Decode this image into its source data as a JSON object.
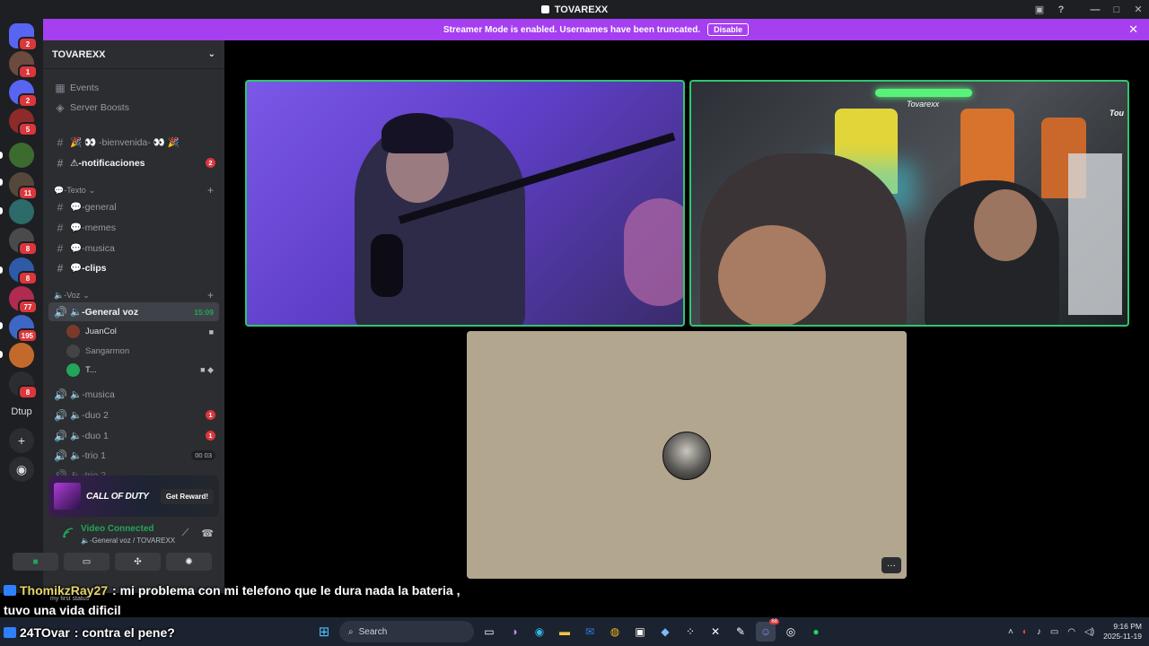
{
  "window": {
    "title": "TOVAREXX"
  },
  "banner": {
    "message": "Streamer Mode is enabled. Usernames have been truncated.",
    "disable_label": "Disable",
    "close_glyph": "✕"
  },
  "rail": {
    "servers": [
      {
        "name": "home",
        "badge": "2",
        "color": "#5865f2"
      },
      {
        "name": "server-1",
        "badge": "1",
        "color": "#6b4b3e"
      },
      {
        "name": "server-2",
        "badge": "2",
        "color": "#5865f2"
      },
      {
        "name": "server-3",
        "badge": "5",
        "color": "#8e2a2a"
      },
      {
        "name": "server-4",
        "badge": "",
        "color": "#3c6b2f"
      },
      {
        "name": "server-5",
        "badge": "11",
        "color": "#55483a"
      },
      {
        "name": "server-6",
        "badge": "",
        "color": "#2d6a6a"
      },
      {
        "name": "server-7",
        "badge": "8",
        "color": "#4a4a4a"
      },
      {
        "name": "server-8",
        "badge": "8",
        "color": "#2e5aa8"
      },
      {
        "name": "server-9",
        "badge": "77",
        "color": "#b12a50"
      },
      {
        "name": "server-10",
        "badge": "195",
        "color": "#3d66c6"
      },
      {
        "name": "server-11",
        "badge": "",
        "color": "#c26a2b"
      },
      {
        "name": "server-12",
        "badge": "8",
        "color": "#2b2d31"
      }
    ],
    "folder_label": "Dtup",
    "add_glyph": "+",
    "discover_glyph": "◉"
  },
  "sidebar": {
    "server_name": "TOVAREXX",
    "items": [
      {
        "type": "link",
        "label": "Events",
        "icon": "calendar-icon"
      },
      {
        "type": "link",
        "label": "Server Boosts",
        "icon": "boost-icon"
      }
    ],
    "channels_top": [
      {
        "label": "🎉 👀 -bienvenida- 👀 🎉",
        "bright": false,
        "badge": ""
      },
      {
        "label": "⚠-notificaciones",
        "bright": true,
        "badge": "2"
      }
    ],
    "category_text": "💬-Texto",
    "text_channels": [
      {
        "label": "💬-general",
        "bright": false
      },
      {
        "label": "💬-memes",
        "bright": false
      },
      {
        "label": "💬-musica",
        "bright": false
      },
      {
        "label": "💬-clips",
        "bright": true
      }
    ],
    "category_voice": "🔈-Voz",
    "active_voice": {
      "label": "🔈-General voz",
      "timer": "15:09"
    },
    "voice_users": [
      {
        "name": "JuanCol",
        "muted": false,
        "end": "🎥"
      },
      {
        "name": "Sangarmon",
        "muted": true,
        "end": ""
      },
      {
        "name": "T...",
        "muted": false,
        "end": "🎥 💬"
      }
    ],
    "voice_channels": [
      {
        "label": "🔈-musica",
        "badge": "",
        "count": ""
      },
      {
        "label": "🔈-duo 2",
        "badge": "1",
        "count": ""
      },
      {
        "label": "🔈-duo 1",
        "badge": "1",
        "count": ""
      },
      {
        "label": "🔈-trio 1",
        "badge": "",
        "count": "00 03"
      },
      {
        "label": "🔈-trio 2",
        "badge": "",
        "count": ""
      }
    ]
  },
  "promo": {
    "game": "CALL OF DUTY",
    "reward_label": "Get Reward!"
  },
  "voice_panel": {
    "status": "Video Connected",
    "location": "🔈-General voz / TOVAREXX",
    "buttons": [
      "camera",
      "screen-share",
      "activities",
      "soundboard"
    ]
  },
  "status_peek": "my first status",
  "chat": [
    {
      "user": "ThomikzRay27",
      "text": ": mi problema con mi telefono que le dura nada la bateria ,",
      "user_color": "#ffd15c"
    },
    {
      "user": "",
      "text": "tuvo una vida dificil",
      "user_color": "#ffffff"
    },
    {
      "user": "24TOvar",
      "text": ": contra el pene?",
      "user_color": "#ffffff"
    }
  ],
  "overlay_text": {
    "name_tag": "Tovarexx",
    "corner_tag": "Tou"
  },
  "taskbar": {
    "search_placeholder": "Search",
    "time": "9:16 PM",
    "date": "2025-11-19",
    "discord_badge": "68"
  }
}
